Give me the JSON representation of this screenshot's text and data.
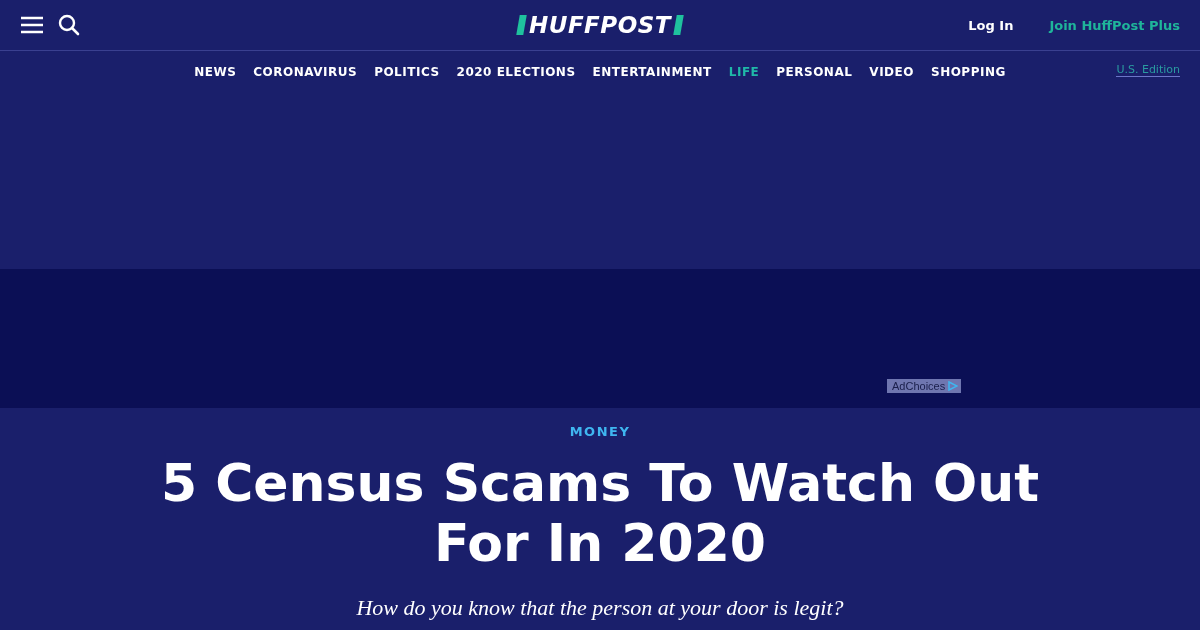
{
  "header": {
    "logo": "HUFFPOST",
    "login": "Log In",
    "join": "Join HuffPost Plus"
  },
  "nav": [
    {
      "label": "NEWS",
      "selected": false
    },
    {
      "label": "CORONAVIRUS",
      "selected": false
    },
    {
      "label": "POLITICS",
      "selected": false
    },
    {
      "label": "2020 ELECTIONS",
      "selected": false
    },
    {
      "label": "ENTERTAINMENT",
      "selected": false
    },
    {
      "label": "LIFE",
      "selected": true
    },
    {
      "label": "PERSONAL",
      "selected": false
    },
    {
      "label": "VIDEO",
      "selected": false
    },
    {
      "label": "SHOPPING",
      "selected": false
    }
  ],
  "edition": "U.S. Edition",
  "ad": {
    "label": "AdChoices"
  },
  "article": {
    "section": "MONEY",
    "headline": "5 Census Scams To Watch Out For In 2020",
    "subtitle": "How do you know that the person at your door is legit?"
  }
}
